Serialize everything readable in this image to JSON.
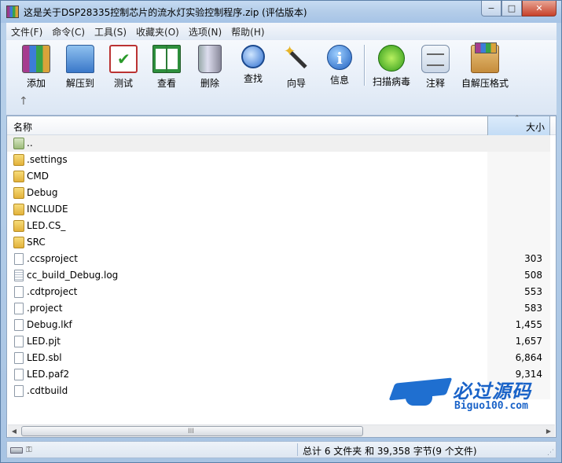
{
  "window": {
    "title": "这是关于DSP28335控制芯片的流水灯实验控制程序.zip (评估版本)",
    "controls": {
      "minimize": "−",
      "maximize": "□",
      "close": "✕"
    }
  },
  "menu": [
    "文件(F)",
    "命令(C)",
    "工具(S)",
    "收藏夹(O)",
    "选项(N)",
    "帮助(H)"
  ],
  "toolbar": {
    "buttons": [
      {
        "label": "添加",
        "icon": "add-archive-icon"
      },
      {
        "label": "解压到",
        "icon": "extract-icon"
      },
      {
        "label": "测试",
        "icon": "test-icon"
      },
      {
        "label": "查看",
        "icon": "view-book-icon"
      },
      {
        "label": "删除",
        "icon": "trash-icon"
      },
      {
        "label": "查找",
        "icon": "magnifier-icon"
      },
      {
        "label": "向导",
        "icon": "wizard-wand-icon"
      },
      {
        "label": "信息",
        "icon": "info-icon"
      },
      {
        "label": "扫描病毒",
        "icon": "virus-scan-icon"
      },
      {
        "label": "注释",
        "icon": "comment-icon"
      },
      {
        "label": "自解压格式",
        "icon": "sfx-box-icon"
      }
    ],
    "up_arrow": "↑"
  },
  "list": {
    "headers": {
      "name": "名称",
      "size": "大小",
      "sort_indicator": "ˆ"
    },
    "rows": [
      {
        "name": "..",
        "size": "",
        "type": "parent"
      },
      {
        "name": ".settings",
        "size": "",
        "type": "folder"
      },
      {
        "name": "CMD",
        "size": "",
        "type": "folder"
      },
      {
        "name": "Debug",
        "size": "",
        "type": "folder"
      },
      {
        "name": "INCLUDE",
        "size": "",
        "type": "folder"
      },
      {
        "name": "LED.CS_",
        "size": "",
        "type": "folder"
      },
      {
        "name": "SRC",
        "size": "",
        "type": "folder"
      },
      {
        "name": ".ccsproject",
        "size": "303",
        "type": "file"
      },
      {
        "name": "cc_build_Debug.log",
        "size": "508",
        "type": "log"
      },
      {
        "name": ".cdtproject",
        "size": "553",
        "type": "file"
      },
      {
        "name": ".project",
        "size": "583",
        "type": "file"
      },
      {
        "name": "Debug.lkf",
        "size": "1,455",
        "type": "file"
      },
      {
        "name": "LED.pjt",
        "size": "1,657",
        "type": "file"
      },
      {
        "name": "LED.sbl",
        "size": "6,864",
        "type": "file"
      },
      {
        "name": "LED.paf2",
        "size": "9,314",
        "type": "file"
      },
      {
        "name": ".cdtbuild",
        "size": "",
        "type": "file"
      }
    ]
  },
  "watermark": {
    "title": "必过源码",
    "subtitle": "Biguo100.com"
  },
  "scrollbar": {
    "left": "◀",
    "right": "▶",
    "grip": "III"
  },
  "status": {
    "summary": "总计 6 文件夹 和 39,358 字节(9 个文件)"
  },
  "colors": {
    "title_bg": "#b3cde9",
    "size_header_bg": "#c3dcf5",
    "watermark": "#1a63c8"
  }
}
